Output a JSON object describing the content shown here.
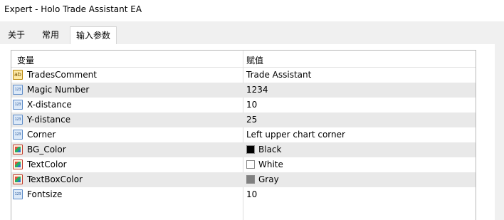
{
  "window": {
    "title": "Expert - Holo Trade Assistant EA"
  },
  "tabs": [
    {
      "label": "关于",
      "active": false
    },
    {
      "label": "常用",
      "active": false
    },
    {
      "label": "输入参数",
      "active": true
    }
  ],
  "params": {
    "header": {
      "name": "变量",
      "value": "赋值"
    },
    "rows": [
      {
        "name": "TradesComment",
        "value": "Trade Assistant",
        "type": "string",
        "icon": "string-type-icon"
      },
      {
        "name": "Magic Number",
        "value": "1234",
        "type": "int",
        "icon": "integer-type-icon"
      },
      {
        "name": "X-distance",
        "value": "10",
        "type": "int",
        "icon": "integer-type-icon"
      },
      {
        "name": "Y-distance",
        "value": "25",
        "type": "int",
        "icon": "integer-type-icon"
      },
      {
        "name": "Corner",
        "value": "Left upper chart corner",
        "type": "enum",
        "icon": "integer-type-icon"
      },
      {
        "name": "BG_Color",
        "value": "Black",
        "type": "color",
        "icon": "color-type-icon",
        "swatch": "#000000"
      },
      {
        "name": "TextColor",
        "value": "White",
        "type": "color",
        "icon": "color-type-icon",
        "swatch": "#ffffff"
      },
      {
        "name": "TextBoxColor",
        "value": "Gray",
        "type": "color",
        "icon": "color-type-icon",
        "swatch": "#808080"
      },
      {
        "name": "Fontsize",
        "value": "10",
        "type": "int",
        "icon": "integer-type-icon"
      }
    ]
  },
  "colors": {
    "alt_row": "#e9e9e9",
    "tab_strip": "#f0f0f0"
  }
}
